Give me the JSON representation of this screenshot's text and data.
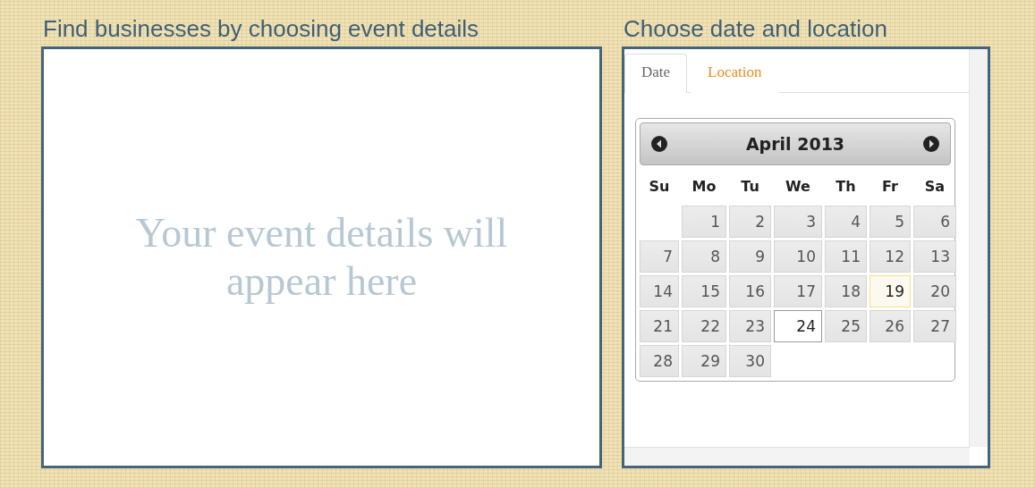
{
  "left": {
    "title": "Find businesses by choosing event details",
    "placeholder": "Your event details will appear here"
  },
  "right": {
    "title": "Choose date and location",
    "tabs": [
      {
        "label": "Date",
        "selected": true
      },
      {
        "label": "Location",
        "selected": false
      }
    ],
    "calendar": {
      "month": "April 2013",
      "weekdays": [
        "Su",
        "Mo",
        "Tu",
        "We",
        "Th",
        "Fr",
        "Sa"
      ],
      "weeks": [
        [
          {
            "label": "1",
            "today": false,
            "selected": false
          },
          {
            "label": "2",
            "today": false,
            "selected": false
          },
          {
            "label": "3",
            "today": false,
            "selected": false
          },
          {
            "label": "4",
            "today": false,
            "selected": false
          },
          {
            "label": "5",
            "today": false,
            "selected": false
          },
          {
            "label": "6",
            "today": false,
            "selected": false
          }
        ],
        [
          {
            "label": "7",
            "today": false,
            "selected": false
          },
          {
            "label": "8",
            "today": false,
            "selected": false
          },
          {
            "label": "9",
            "today": false,
            "selected": false
          },
          {
            "label": "10",
            "today": false,
            "selected": false
          },
          {
            "label": "11",
            "today": false,
            "selected": false
          },
          {
            "label": "12",
            "today": false,
            "selected": false
          },
          {
            "label": "13",
            "today": false,
            "selected": false
          }
        ],
        [
          {
            "label": "14",
            "today": false,
            "selected": false
          },
          {
            "label": "15",
            "today": false,
            "selected": false
          },
          {
            "label": "16",
            "today": false,
            "selected": false
          },
          {
            "label": "17",
            "today": false,
            "selected": false
          },
          {
            "label": "18",
            "today": false,
            "selected": false
          },
          {
            "label": "19",
            "today": true,
            "selected": false
          },
          {
            "label": "20",
            "today": false,
            "selected": false
          }
        ],
        [
          {
            "label": "21",
            "today": false,
            "selected": false
          },
          {
            "label": "22",
            "today": false,
            "selected": false
          },
          {
            "label": "23",
            "today": false,
            "selected": false
          },
          {
            "label": "24",
            "today": false,
            "selected": true
          },
          {
            "label": "25",
            "today": false,
            "selected": false
          },
          {
            "label": "26",
            "today": false,
            "selected": false
          },
          {
            "label": "27",
            "today": false,
            "selected": false
          }
        ],
        [
          {
            "label": "28",
            "today": false,
            "selected": false
          },
          {
            "label": "29",
            "today": false,
            "selected": false
          },
          {
            "label": "30",
            "today": false,
            "selected": false
          }
        ]
      ]
    }
  }
}
